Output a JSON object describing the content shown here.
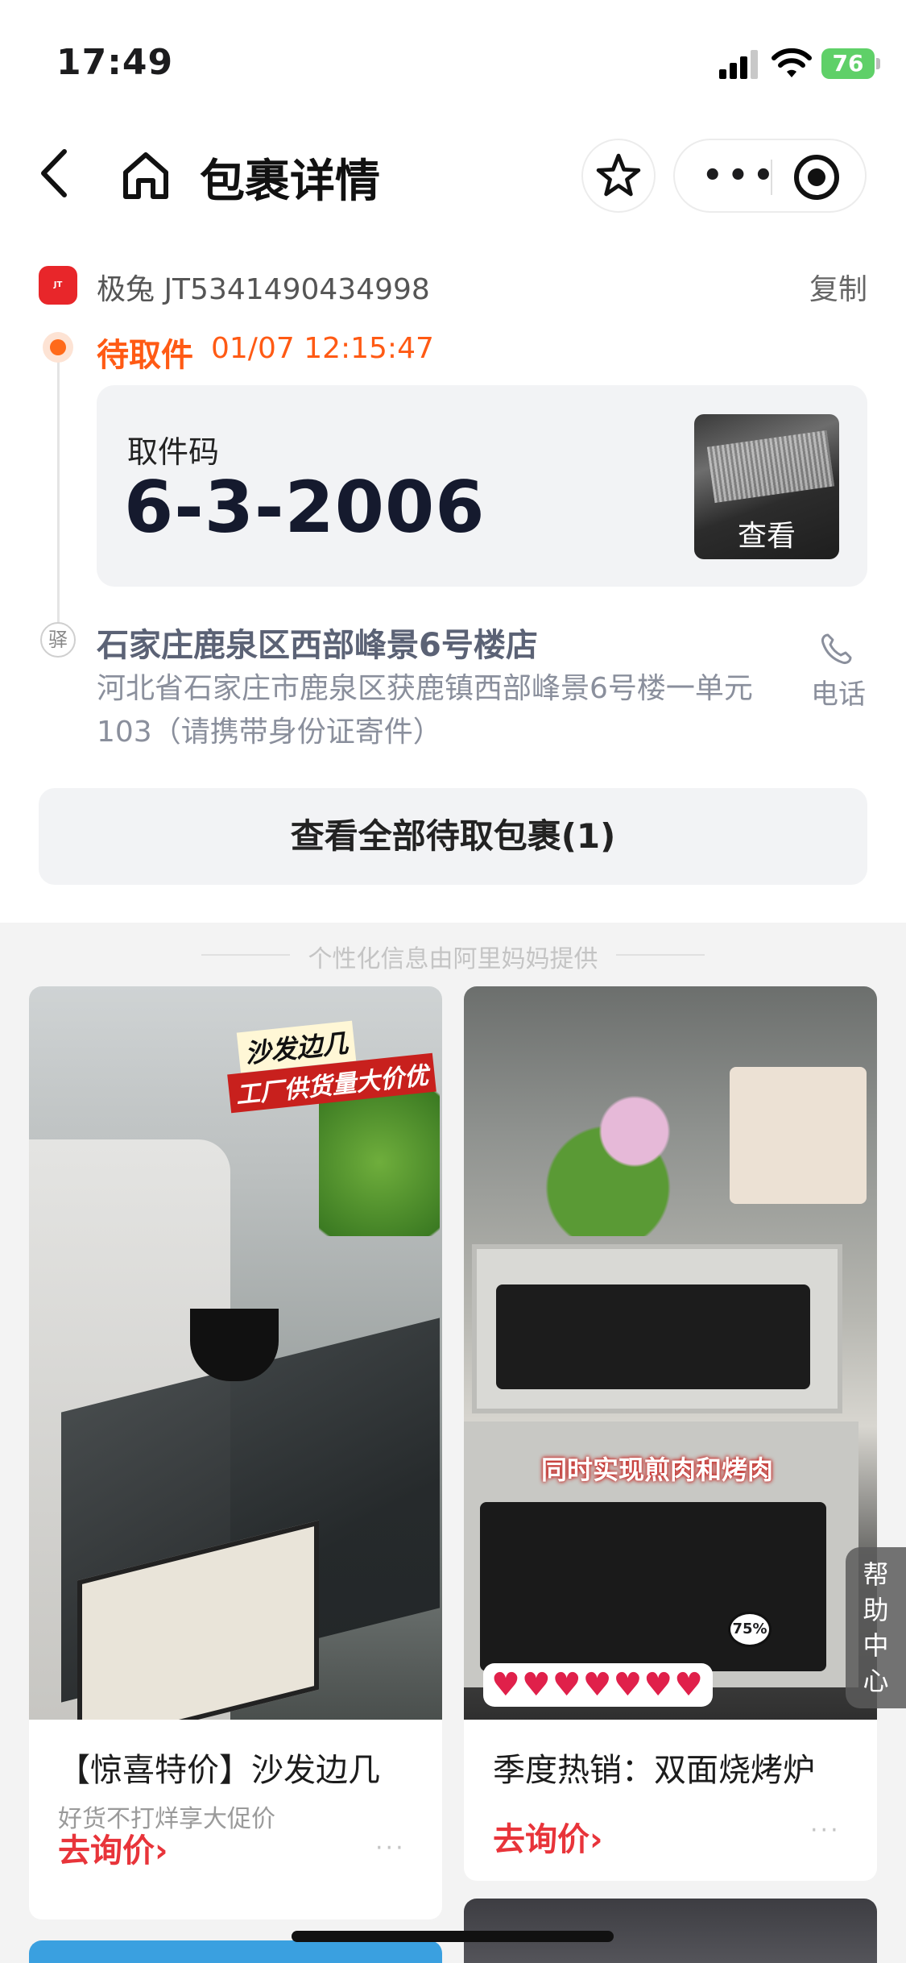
{
  "status_bar": {
    "time": "17:49",
    "battery": "76"
  },
  "nav": {
    "title": "包裹详情",
    "icons": [
      "back-icon",
      "home-icon",
      "star-icon",
      "more-icon",
      "target-icon"
    ]
  },
  "parcel": {
    "carrier_logo_text": "JT",
    "carrier_line": "极兔 JT5341490434998",
    "copy_label": "复制",
    "status": "待取件",
    "status_time": "01/07 12:15:47",
    "pickup_label": "取件码",
    "pickup_code": "6-3-2006",
    "photo_label": "查看",
    "station_icon_text": "驿",
    "station_name": "石家庄鹿泉区西部峰景6号楼店",
    "station_address": "河北省石家庄市鹿泉区获鹿镇西部峰景6号楼一单元103（请携带身份证寄件）",
    "phone_label": "电话",
    "view_all_label": "查看全部待取包裹(1)"
  },
  "feed": {
    "note": "个性化信息由阿里妈妈提供",
    "products": [
      {
        "image_tags": [
          "沙发边几",
          "工厂供货量大价优"
        ],
        "title": "【惊喜特价】沙发边几",
        "subtitle": "好货不打烊享大促价",
        "cta": "去询价›",
        "more": "···"
      },
      {
        "image_caption": "同时实现煎肉和烤肉",
        "image_hearts": "♥♥♥♥♥♥♥",
        "image_percent": "75%",
        "title": "季度热销：双面烧烤炉",
        "cta": "去询价›",
        "more": "···"
      }
    ]
  },
  "help_tab": {
    "chars": [
      "帮",
      "助",
      "中",
      "心"
    ]
  },
  "colors": {
    "accent_orange": "#ff5a14",
    "cta_red": "#e8343a",
    "carrier_red": "#e8262a"
  }
}
